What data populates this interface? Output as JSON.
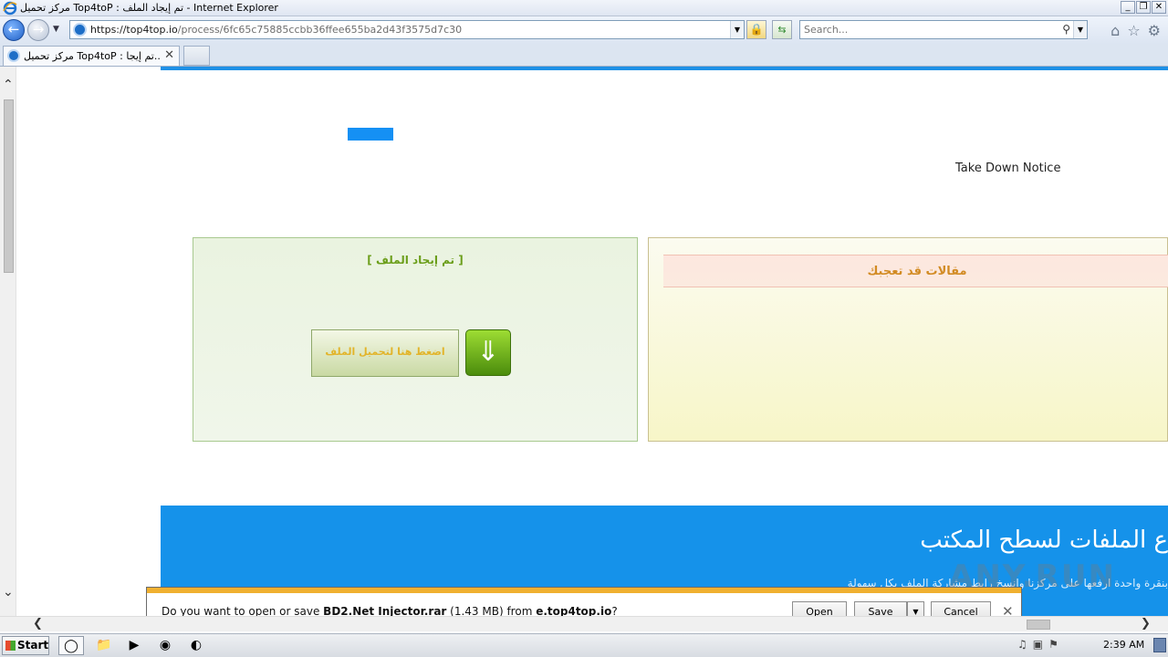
{
  "window": {
    "title": "مركز تحميل Top4toP : تم إيجاد الملف - Internet Explorer",
    "controls": [
      "_",
      "❐",
      "✕"
    ]
  },
  "nav": {
    "url_host": "https://top4top.io",
    "url_path": "/process/6fc65c75885ccbb36ffee655ba2d43f3575d7c30",
    "search_placeholder": "Search..."
  },
  "tabs": [
    {
      "label": "مركز تحميل Top4toP : تم إيجا..."
    }
  ],
  "page": {
    "take_down": "Take Down Notice",
    "file_found": "[ تم إيجاد الملف ]",
    "download_button": "اضغط هنا لتحميل الملف",
    "articles_heading": "مقالات قد تعجبك",
    "band_heading": "ع الملفات لسطح المكتب",
    "band_subtext": "بنقرة واحدة ارفعها على مركزنا وانسخ رابط مشاركة الملف بكل سهولة",
    "colors": {
      "accent": "#1592ea",
      "green": "#6b9e1a",
      "orange": "#d28b23"
    }
  },
  "download_bar": {
    "prefix": "Do you want to open or save ",
    "filename": "BD2.Net Injector.rar",
    "size": " (1.43 MB) from ",
    "source": "e.top4top.io",
    "suffix": "?",
    "open": "Open",
    "save": "Save",
    "cancel": "Cancel"
  },
  "taskbar": {
    "start": "Start",
    "clock": "2:39 AM"
  },
  "watermark": "ANY.RUN"
}
